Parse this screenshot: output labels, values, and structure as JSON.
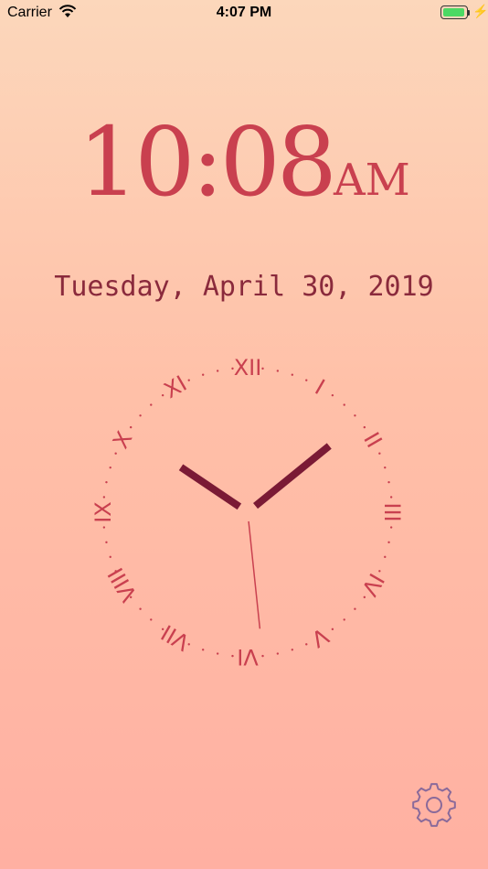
{
  "status_bar": {
    "carrier": "Carrier",
    "wifi_icon": "wifi-icon",
    "time": "4:07 PM",
    "battery_icon": "battery-icon",
    "battery_level": 1.0,
    "charging_icon": "bolt-icon",
    "charging_glyph": "⚡"
  },
  "digital_clock": {
    "time": "10:08",
    "ampm": "AM",
    "color": "#c9404f"
  },
  "date_text": "Tuesday, April 30, 2019",
  "analog_clock": {
    "numerals": [
      "XII",
      "I",
      "II",
      "III",
      "IV",
      "V",
      "VI",
      "VII",
      "VIII",
      "IX",
      "X",
      "XI"
    ],
    "hour": 10,
    "minute": 8,
    "second": 29,
    "hand_color": "#7a1a35",
    "numeral_color": "#c9404f"
  },
  "settings": {
    "icon": "gear-icon",
    "color": "#8a6a9a"
  }
}
